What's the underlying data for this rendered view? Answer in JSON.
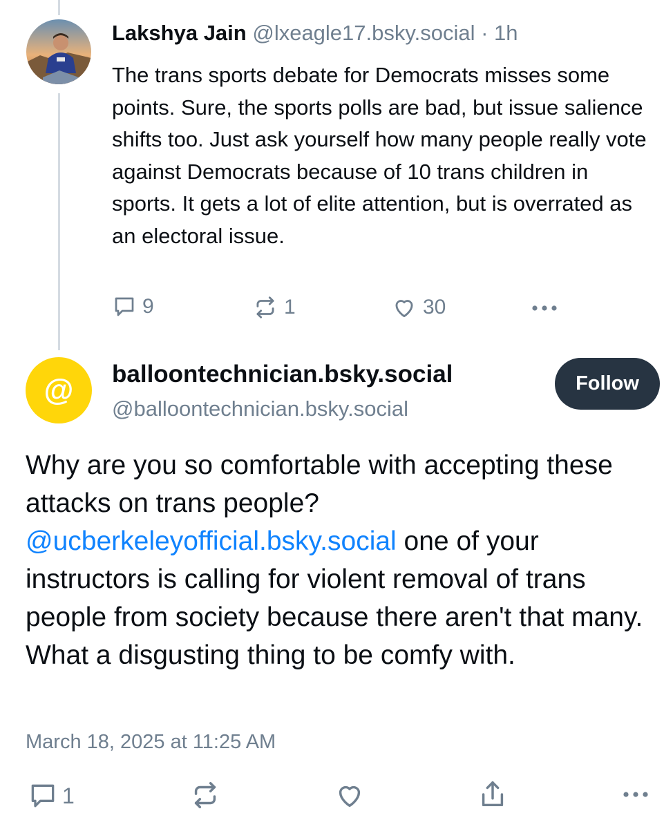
{
  "parent_post": {
    "author_name": "Lakshya Jain",
    "author_handle": "@lxeagle17.bsky.social",
    "separator": " · ",
    "age": "1h",
    "text": "The trans sports debate for Democrats misses some points. Sure, the sports polls are bad, but issue salience shifts too. Just ask yourself how many people really vote against Democrats because of 10 trans children in sports. It gets a lot of elite attention, but is overrated as an electoral issue.",
    "reply_count": "9",
    "repost_count": "1",
    "like_count": "30"
  },
  "main_post": {
    "avatar_symbol": "@",
    "avatar_color": "#ffd60a",
    "display_name": "balloontechnician.bsky.social",
    "handle": "@balloontechnician.bsky.social",
    "follow_label": "Follow",
    "text_before_mention": "Why are you so comfortable with accepting these attacks on trans people? ",
    "mention": "@ucberkeleyofficial.bsky.social",
    "text_after_mention": " one of your instructors is calling for violent removal of trans people from society because there aren't that many. What a disgusting thing to be comfy with.",
    "timestamp": "March 18, 2025 at 11:25 AM",
    "reply_count": "1"
  },
  "colors": {
    "text": "#0b0f14",
    "muted": "#6f7f8f",
    "link": "#1083fe",
    "follow_button": "#273442",
    "thread_line": "#d4dbe2"
  },
  "icons": {
    "reply": "speech-bubble-icon",
    "repost": "repost-arrows-icon",
    "like": "heart-icon",
    "share": "share-upload-icon",
    "more": "ellipsis-icon"
  }
}
